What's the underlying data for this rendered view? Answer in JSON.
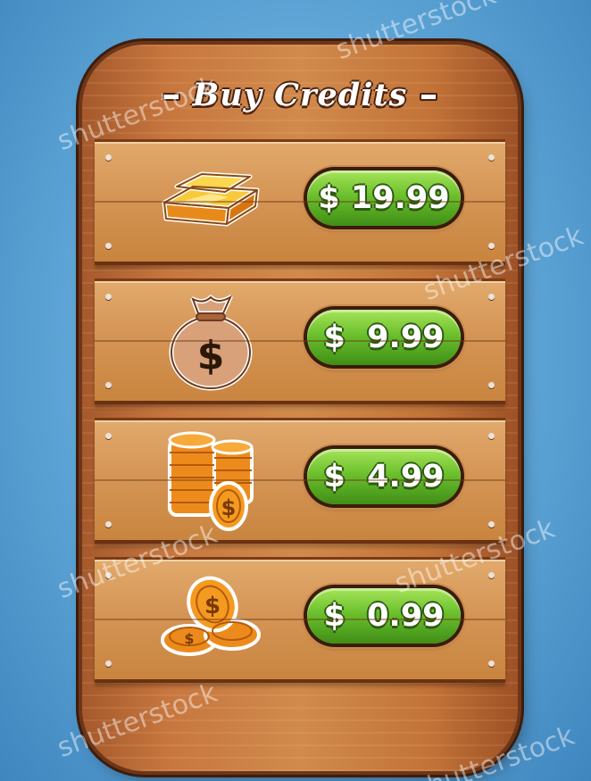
{
  "panel": {
    "title": "Buy Credits",
    "items": [
      {
        "icon": "gold-bars-icon",
        "price": "$ 19.99"
      },
      {
        "icon": "money-bag-icon",
        "price": "$  9.99"
      },
      {
        "icon": "coin-stack-icon",
        "price": "$  4.99"
      },
      {
        "icon": "coins-icon",
        "price": "$  0.99"
      }
    ]
  },
  "watermarks": [
    "shutterstock",
    "shutterstock",
    "shutterstock",
    "shutterstock",
    "shutterstock",
    "shutterstock",
    "shutterstock"
  ],
  "colors": {
    "background": "#5ea5d6",
    "wood": "#d18a4c",
    "button_green": "#6cc02d",
    "gold": "#f5b31c",
    "coin": "#ec8b1c",
    "bag": "#d8a17a"
  }
}
